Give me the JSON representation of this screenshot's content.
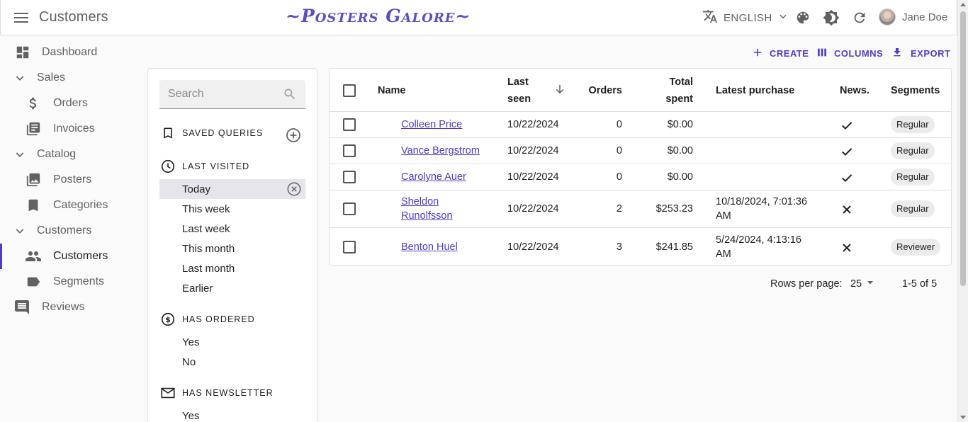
{
  "appbar": {
    "title": "Customers",
    "brand": "~Posters Galore~",
    "language": "ENGLISH",
    "user_name": "Jane Doe"
  },
  "sidebar": {
    "items": [
      {
        "label": "Dashboard",
        "icon": "dashboard-icon"
      },
      {
        "label": "Sales",
        "icon": "chevron-down-icon"
      },
      {
        "label": "Orders",
        "icon": "dollar-icon"
      },
      {
        "label": "Invoices",
        "icon": "invoices-icon"
      },
      {
        "label": "Catalog",
        "icon": "chevron-down-icon"
      },
      {
        "label": "Posters",
        "icon": "image-icon"
      },
      {
        "label": "Categories",
        "icon": "bookmark-icon"
      },
      {
        "label": "Customers",
        "icon": "chevron-down-icon"
      },
      {
        "label": "Customers",
        "icon": "people-icon"
      },
      {
        "label": "Segments",
        "icon": "label-icon"
      },
      {
        "label": "Reviews",
        "icon": "comment-icon"
      }
    ]
  },
  "filters": {
    "search_placeholder": "Search",
    "saved_queries": "SAVED QUERIES",
    "last_visited": {
      "title": "LAST VISITED",
      "options": [
        "Today",
        "This week",
        "Last week",
        "This month",
        "Last month",
        "Earlier"
      ],
      "selected": "Today"
    },
    "has_ordered": {
      "title": "HAS ORDERED",
      "options": [
        "Yes",
        "No"
      ]
    },
    "has_newsletter": {
      "title": "HAS NEWSLETTER",
      "options": [
        "Yes"
      ]
    }
  },
  "toolbar": {
    "create": "CREATE",
    "columns": "COLUMNS",
    "export": "EXPORT"
  },
  "table": {
    "headers": {
      "name": "Name",
      "last_seen_1": "Last",
      "last_seen_2": "seen",
      "orders": "Orders",
      "total_spent_1": "Total",
      "total_spent_2": "spent",
      "latest_purchase": "Latest purchase",
      "news": "News.",
      "segments": "Segments"
    },
    "sort": "descending",
    "rows": [
      {
        "name_1": "Colleen Price",
        "name_2": "",
        "last_seen": "10/22/2024",
        "orders": "0",
        "total_spent": "$0.00",
        "latest_1": "",
        "latest_2": "",
        "newsletter": true,
        "segment": "Regular"
      },
      {
        "name_1": "Vance Bergstrom",
        "name_2": "",
        "last_seen": "10/22/2024",
        "orders": "0",
        "total_spent": "$0.00",
        "latest_1": "",
        "latest_2": "",
        "newsletter": true,
        "segment": "Regular"
      },
      {
        "name_1": "Carolyne Auer",
        "name_2": "",
        "last_seen": "10/22/2024",
        "orders": "0",
        "total_spent": "$0.00",
        "latest_1": "",
        "latest_2": "",
        "newsletter": true,
        "segment": "Regular"
      },
      {
        "name_1": "Sheldon",
        "name_2": "Runolfsson",
        "last_seen": "10/22/2024",
        "orders": "2",
        "total_spent": "$253.23",
        "latest_1": "10/18/2024, 7:01:36",
        "latest_2": "AM",
        "newsletter": false,
        "segment": "Regular"
      },
      {
        "name_1": "Benton Huel",
        "name_2": "",
        "last_seen": "10/22/2024",
        "orders": "3",
        "total_spent": "$241.85",
        "latest_1": "5/24/2024, 4:13:16",
        "latest_2": "AM",
        "newsletter": false,
        "segment": "Reviewer"
      }
    ]
  },
  "pagination": {
    "rows_per_page_label": "Rows per page:",
    "rows_per_page": "25",
    "range": "1-5 of 5"
  },
  "colors": {
    "primary": "#4f3cc9",
    "brand": "#5a4fc4",
    "text_secondary": "#616161"
  }
}
